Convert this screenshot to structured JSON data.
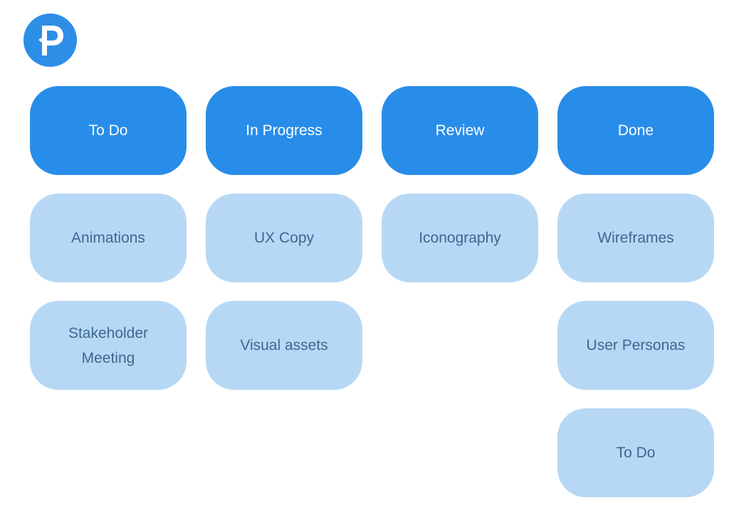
{
  "logo": {
    "letter": "P",
    "icon": "p-logo-icon",
    "color": "#2d8ee6"
  },
  "colors": {
    "header_bg": "#288de8",
    "header_text": "#ffffff",
    "task_bg": "#b7d8f5",
    "task_text": "#3c6890"
  },
  "columns": [
    {
      "title": "To Do",
      "tasks": [
        "Animations",
        "Stakeholder\nMeeting"
      ]
    },
    {
      "title": "In Progress",
      "tasks": [
        "UX Copy",
        "Visual assets"
      ]
    },
    {
      "title": "Review",
      "tasks": [
        "Iconography"
      ]
    },
    {
      "title": "Done",
      "tasks": [
        "Wireframes",
        "User Personas",
        "To Do"
      ]
    }
  ]
}
